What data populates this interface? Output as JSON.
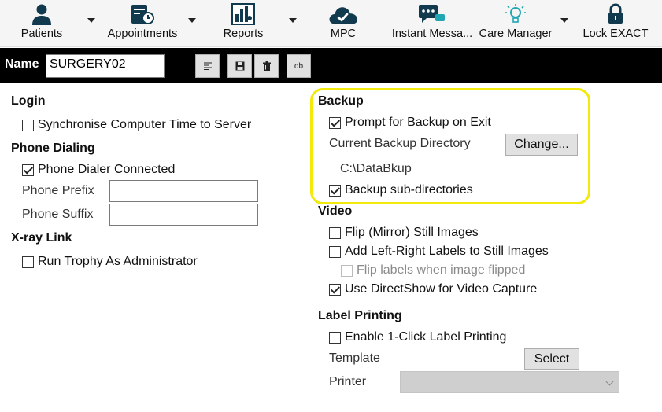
{
  "toolbar": {
    "items": [
      {
        "label": "Patients",
        "icon": "patient-icon"
      },
      {
        "label": "Appointments",
        "icon": "calendar-clock-icon"
      },
      {
        "label": "Reports",
        "icon": "report-chart-icon"
      },
      {
        "label": "MPC",
        "icon": "cloud-check-icon"
      },
      {
        "label": "Instant Messa...",
        "icon": "chat-icon"
      },
      {
        "label": "Care Manager",
        "icon": "lightbulb-icon"
      },
      {
        "label": "Lock EXACT",
        "icon": "padlock-icon"
      }
    ]
  },
  "namebar": {
    "label": "Name",
    "value": "SURGERY02",
    "db_label": "db"
  },
  "login": {
    "title": "Login",
    "sync_time": {
      "label": "Synchronise Computer Time to Server",
      "checked": false
    }
  },
  "phone": {
    "title": "Phone Dialing",
    "connected": {
      "label": "Phone Dialer Connected",
      "checked": true
    },
    "prefix_label": "Phone Prefix",
    "prefix_value": "",
    "suffix_label": "Phone Suffix",
    "suffix_value": ""
  },
  "xray": {
    "title": "X-ray Link",
    "run_admin": {
      "label": "Run Trophy As Administrator",
      "checked": false
    }
  },
  "backup": {
    "title": "Backup",
    "prompt": {
      "label": "Prompt for Backup on Exit",
      "checked": true
    },
    "dir_label": "Current Backup Directory",
    "change_button": "Change...",
    "dir_value": "C:\\DataBkup",
    "subdirs": {
      "label": "Backup sub-directories",
      "checked": true
    },
    "highlight_color": "#f2ea0a"
  },
  "video": {
    "title": "Video",
    "flip": {
      "label": "Flip (Mirror) Still Images",
      "checked": false
    },
    "lr_labels": {
      "label": "Add Left-Right Labels to Still Images",
      "checked": false
    },
    "flip_labels": {
      "label": "Flip labels when image flipped",
      "checked": false,
      "disabled": true
    },
    "directshow": {
      "label": "Use DirectShow for Video Capture",
      "checked": true
    }
  },
  "label_printing": {
    "title": "Label Printing",
    "one_click": {
      "label": "Enable 1-Click Label Printing",
      "checked": false
    },
    "template_label": "Template",
    "select_button": "Select",
    "printer_label": "Printer",
    "printer_value": ""
  }
}
